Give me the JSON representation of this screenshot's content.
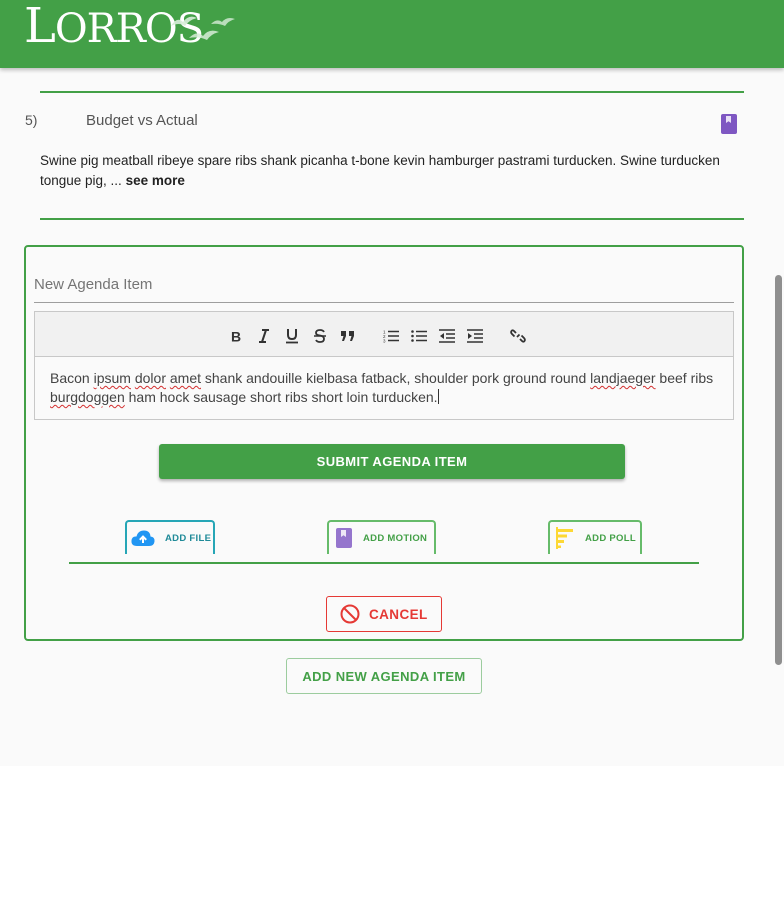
{
  "header": {
    "logo_text": "LORROS",
    "brand_color": "#43a047"
  },
  "agenda_item": {
    "number": "5)",
    "title": "Budget vs Actual",
    "description": "Swine pig meatball ribeye spare ribs shank picanha t-bone kevin hamburger pastrami turducken. Swine turducken tongue pig, ...",
    "see_more": "see more",
    "motion_icon": "motion-flag-icon"
  },
  "new_item_form": {
    "title_placeholder": "New Agenda Item",
    "toolbar": [
      "bold-icon",
      "italic-icon",
      "underline-icon",
      "strikethrough-icon",
      "quote-icon",
      "numbered-list-icon",
      "bulleted-list-icon",
      "outdent-icon",
      "indent-icon",
      "link-icon"
    ],
    "editor_text_parts": [
      "Bacon ",
      "ipsum",
      " ",
      "dolor",
      " ",
      "amet",
      " shank andouille kielbasa fatback, shoulder pork ground round ",
      "landjaeger",
      " beef ribs ",
      "burgdoggen",
      " ham hock sausage short ribs short loin turducken."
    ],
    "submit_label": "SUBMIT AGENDA ITEM",
    "attachments": {
      "file_label": "ADD FILE",
      "motion_label": "ADD MOTION",
      "poll_label": "ADD POLL"
    },
    "cancel_label": "CANCEL"
  },
  "add_new_label": "ADD NEW AGENDA ITEM",
  "colors": {
    "green": "#43a047",
    "purple": "#7e57c2",
    "teal": "#26a6b6",
    "cloud_blue": "#2196f3",
    "poll_yellow": "#fdd835",
    "cancel_red": "#e53935"
  }
}
